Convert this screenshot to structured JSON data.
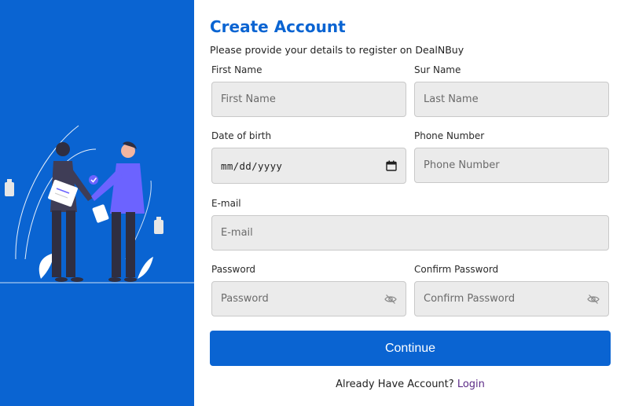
{
  "illustration": {
    "name": "handshake-illustration",
    "colors": {
      "panel": "#0a64d2",
      "accent_person": "#6c63ff",
      "dark_clothes": "#2f2e41"
    }
  },
  "form": {
    "title": "Create Account",
    "subtitle": "Please provide your details to register on DealNBuy",
    "first_name": {
      "label": "First Name",
      "placeholder": "First Name"
    },
    "sur_name": {
      "label": "Sur Name",
      "placeholder": "Last Name"
    },
    "dob": {
      "label": "Date of birth",
      "placeholder": "mm/dd/yyyy",
      "icon": "calendar-icon"
    },
    "phone": {
      "label": "Phone Number",
      "placeholder": "Phone Number"
    },
    "email": {
      "label": "E-mail",
      "placeholder": "E-mail"
    },
    "password": {
      "label": "Password",
      "placeholder": "Password",
      "icon": "eye-slash-icon"
    },
    "confirm_password": {
      "label": "Confirm Password",
      "placeholder": "Confirm Password",
      "icon": "eye-slash-icon"
    },
    "continue_label": "Continue",
    "footer_text": "Already Have Account?",
    "login_label": "Login"
  },
  "colors": {
    "brand": "#0a64d2",
    "input_bg": "#ebebeb",
    "link": "#5b2a86"
  }
}
